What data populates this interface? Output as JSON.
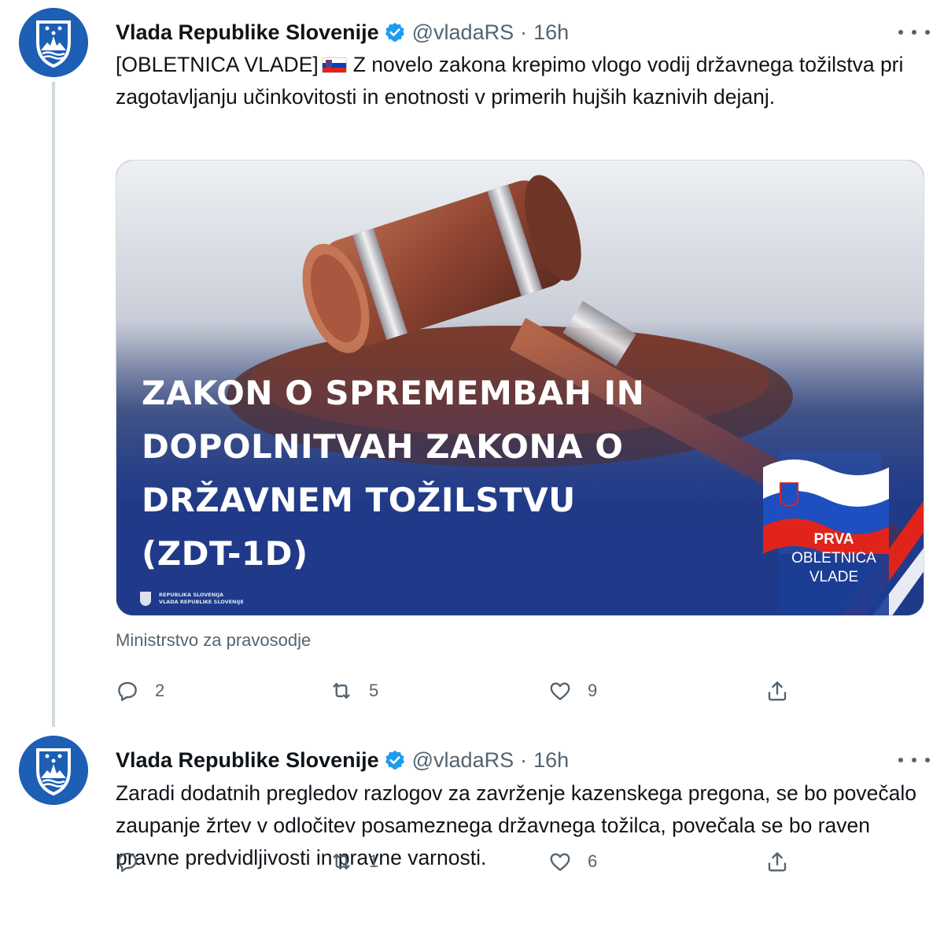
{
  "colors": {
    "accent": "#1d9bf0",
    "avatar_blue": "#1c5fb4",
    "secondary_text": "#536471",
    "banner_navy": "#1f3a8a"
  },
  "tweets": [
    {
      "author_name": "Vlada Republike Slovenije",
      "handle": "@vladaRS",
      "separator": "·",
      "time": "16h",
      "text_prefix": "[OBLETNICA VLADE]",
      "text_body": "Z novelo zakona krepimo vlogo vodij državnega tožilstva pri zagotavljanju učinkovitosti in enotnosti v primerih hujših kaznivih dejanj.",
      "media": {
        "headline_lines": [
          "ZAKON O SPREMEMBAH IN",
          "DOPOLNITVAH ZAKONA O",
          "DRŽAVNEM TOŽILSTVU",
          "(ZDT-1D)"
        ],
        "logo_lines": [
          "REPUBLIKA SLOVENIJA",
          "VLADA REPUBLIKE SLOVENIJE"
        ],
        "badge_line1": "PRVA",
        "badge_line2": "OBLETNICA",
        "badge_line3": "VLADE"
      },
      "caption": "Ministrstvo za pravosodje",
      "replies": "2",
      "retweets": "5",
      "likes": "9"
    },
    {
      "author_name": "Vlada Republike Slovenije",
      "handle": "@vladaRS",
      "separator": "·",
      "time": "16h",
      "text_body": "Zaradi dodatnih pregledov razlogov za zavrženje kazenskega pregona, se bo povečalo zaupanje žrtev v odločitev posameznega državnega tožilca, povečala se bo raven pravne predvidljivosti in pravne varnosti.",
      "replies": "",
      "retweets": "1",
      "likes": "6"
    }
  ]
}
